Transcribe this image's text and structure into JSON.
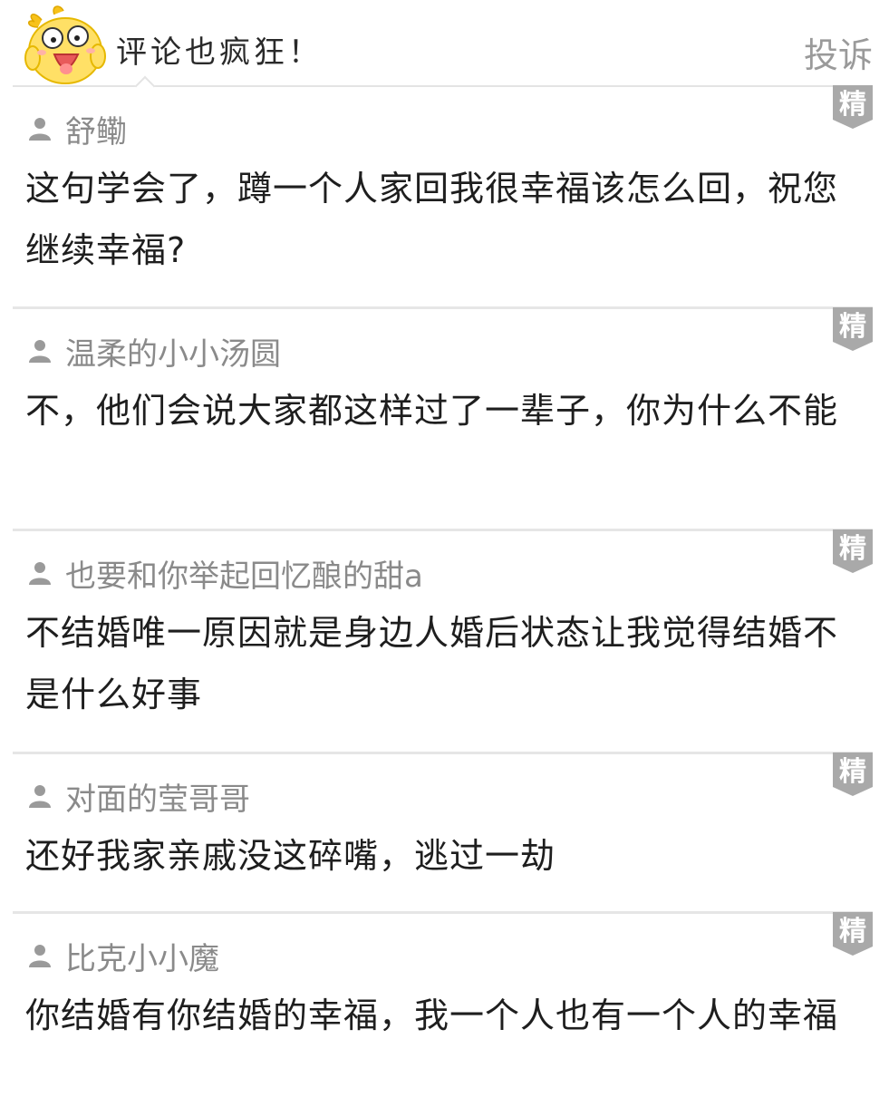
{
  "header": {
    "title": "评论也疯狂！",
    "report_label": "投诉"
  },
  "badge_label": "精",
  "comments": [
    {
      "username": "舒鳓",
      "text": "这句学会了，蹲一个人家回我很幸福该怎么回，祝您继续幸福?"
    },
    {
      "username": "温柔的小小汤圆",
      "text": "不，他们会说大家都这样过了一辈子，你为什么不能"
    },
    {
      "username": "也要和你举起回忆酿的甜a",
      "text": "不结婚唯一原因就是身边人婚后状态让我觉得结婚不是什么好事"
    },
    {
      "username": "对面的莹哥哥",
      "text": "还好我家亲戚没这碎嘴，逃过一劫"
    },
    {
      "username": "比克小小魔",
      "text": "你结婚有你结婚的幸福，我一个人也有一个人的幸福"
    }
  ]
}
